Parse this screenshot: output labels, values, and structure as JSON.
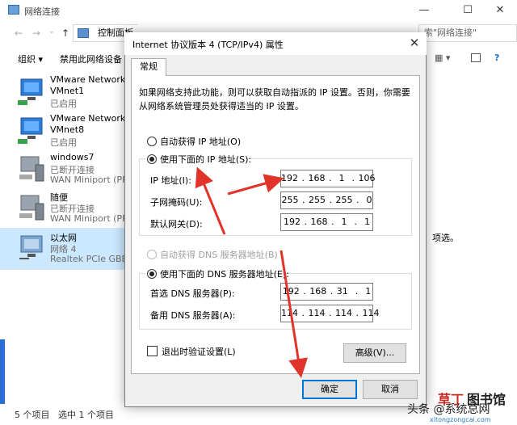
{
  "bg": {
    "title": "网络连接",
    "breadcrumb": "控制面板",
    "search_text": "索\"网络连接\"",
    "toolbar": [
      "组织",
      "禁用此网络设备"
    ],
    "adapters": [
      {
        "name": "VMware Network Ad",
        "sub1": "VMnet1",
        "sub2": "已启用"
      },
      {
        "name": "VMware Network Ad",
        "sub1": "VMnet8",
        "sub2": "已启用"
      },
      {
        "name": "windows7",
        "sub1": "已断开连接",
        "sub2": "WAN Miniport (PPTP"
      },
      {
        "name": "随便",
        "sub1": "已断开连接",
        "sub2": "WAN Miniport (PPTP"
      },
      {
        "name": "以太网",
        "sub1": "网络 4",
        "sub2": "Realtek PCIe GBE Fa"
      }
    ],
    "side_text": "项选。",
    "status_count": "5 个项目",
    "status_selected": "选中 1 个项目"
  },
  "dialog": {
    "title": "Internet 协议版本 4 (TCP/IPv4) 属性",
    "tab": "常规",
    "desc": "如果网络支持此功能，则可以获取自动指派的 IP 设置。否则，你需要从网络系统管理员处获得适当的 IP 设置。",
    "auto_ip": "自动获得 IP 地址(O)",
    "use_ip": "使用下面的 IP 地址(S):",
    "ip_label": "IP 地址(I):",
    "ip_value": "192 . 168 .  1  . 106",
    "mask_label": "子网掩码(U):",
    "mask_value": "255 . 255 . 255 .  0",
    "gw_label": "默认网关(D):",
    "gw_value": "192 . 168 .  1  .  1",
    "auto_dns": "自动获得 DNS 服务器地址(B)",
    "use_dns": "使用下面的 DNS 服务器地址(E):",
    "dns1_label": "首选 DNS 服务器(P):",
    "dns1_value": "192 . 168 . 31  .  1",
    "dns2_label": "备用 DNS 服务器(A):",
    "dns2_value": "114 . 114 . 114 . 114",
    "validate": "退出时验证设置(L)",
    "advanced": "高级(V)...",
    "ok": "确定",
    "cancel": "取消"
  },
  "watermark": {
    "a": "草丁",
    "b": "图书馆",
    "c": "头条 @系统总网",
    "d": "xitongzongcai.com"
  },
  "colors": {
    "arrow": "#e0342b",
    "selection": "#cce8ff",
    "accent": "#0078d7"
  }
}
